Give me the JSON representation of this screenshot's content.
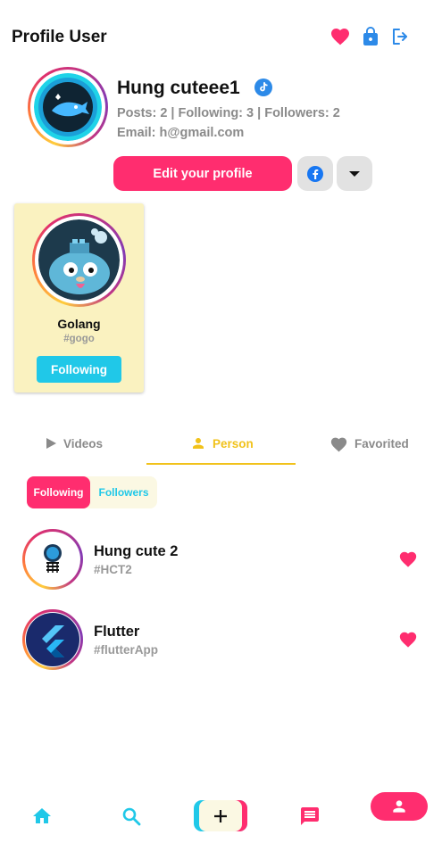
{
  "header": {
    "title": "Profile User"
  },
  "profile": {
    "name": "Hung cuteee1",
    "stats": "Posts: 2 | Following: 3 | Followers: 2",
    "email": "Email: h@gmail.com",
    "edit_label": "Edit your profile"
  },
  "suggested_card": {
    "name": "Golang",
    "tag": "#gogo",
    "button_label": "Following"
  },
  "tabs": [
    {
      "label": "Videos",
      "active": false
    },
    {
      "label": "Person",
      "active": true
    },
    {
      "label": "Favorited",
      "active": false
    }
  ],
  "segment": {
    "following_label": "Following",
    "followers_label": "Followers",
    "selected": "Following"
  },
  "people": [
    {
      "name": "Hung cute 2",
      "tag": "#HCT2"
    },
    {
      "name": "Flutter",
      "tag": "#flutterApp"
    }
  ],
  "icons": {
    "header": [
      "heart-icon",
      "lock-icon",
      "logout-icon"
    ],
    "verified": "tiktok-verified-icon",
    "social": "facebook-icon",
    "dropdown": "caret-down-icon",
    "tabs": [
      "play-icon",
      "person-icon",
      "heart-icon"
    ],
    "nav": [
      "home-icon",
      "search-icon",
      "add-icon",
      "chat-icon",
      "profile-icon"
    ]
  },
  "colors": {
    "accent_pink": "#ff2d6f",
    "accent_cyan": "#20c8e8",
    "active_tab": "#f1c21b",
    "blue": "#2d8ae8",
    "card_bg": "#faf2c0"
  }
}
